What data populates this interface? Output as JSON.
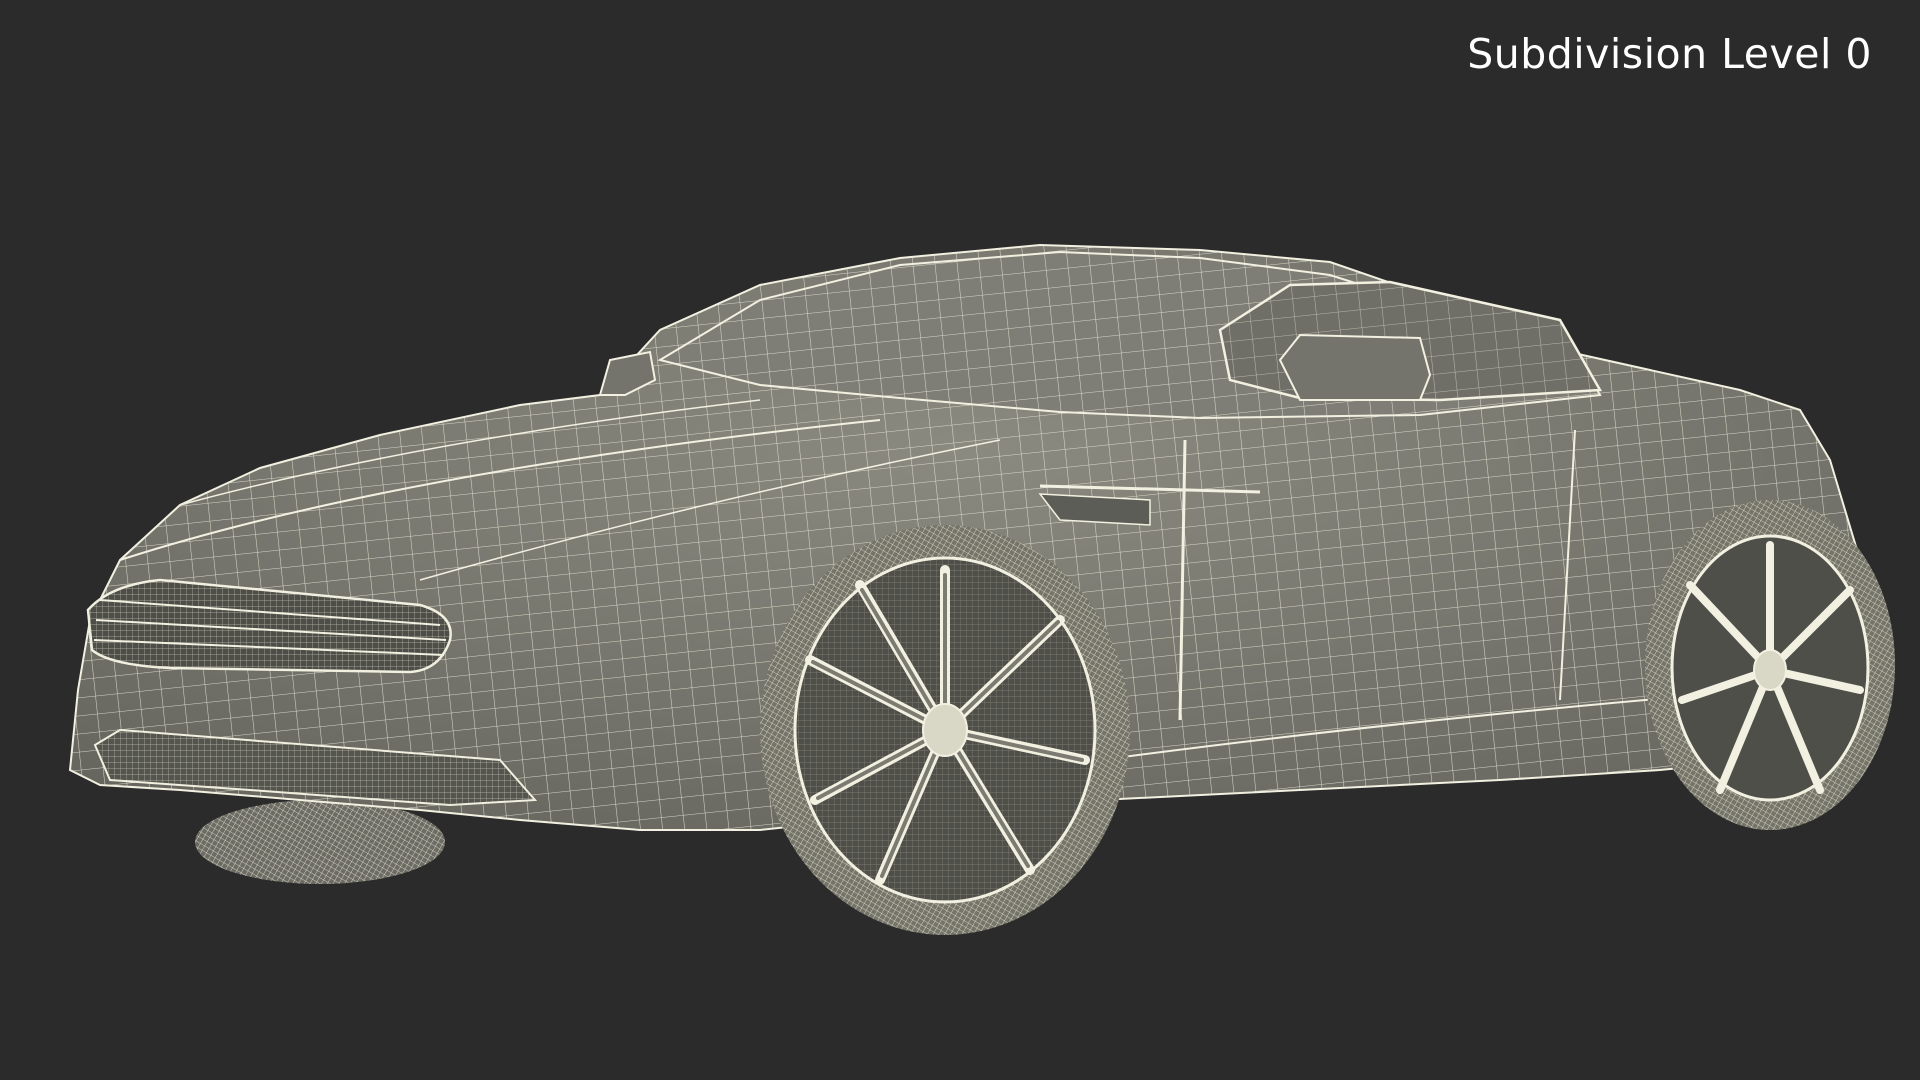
{
  "viewport": {
    "background_color": "#2b2b2b",
    "subdivision_label": "Subdivision Level 0"
  },
  "model": {
    "type": "wireframe-car",
    "body_color": "#7b7b72",
    "wire_color": "#f2f0e0",
    "shadow_color": "#55554e"
  }
}
